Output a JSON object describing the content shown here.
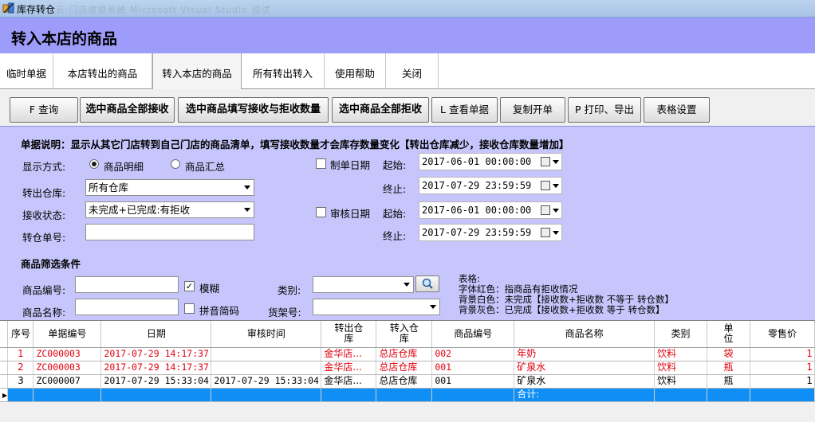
{
  "window": {
    "title": "库存转仓",
    "ghost_text": "云·门店收银系统   Microsoft Visual Studio 调试"
  },
  "page": {
    "title": "转入本店的商品"
  },
  "tabs": [
    "临时单据",
    "本店转出的商品",
    "转入本店的商品",
    "所有转出转入",
    "使用帮助",
    "关闭"
  ],
  "toolbar": [
    "F 查询",
    "选中商品全部接收",
    "选中商品填写接收与拒收数量",
    "选中商品全部拒收",
    "L 查看单据",
    "复制开单",
    "P 打印、导出",
    "表格设置"
  ],
  "filters": {
    "description": "单据说明：显示从其它门店转到自己门店的商品清单，填写接收数量才会库存数量变化【转出仓库减少，接收仓库数量增加】",
    "display_mode_label": "显示方式:",
    "display_mode_options": [
      "商品明细",
      "商品汇总"
    ],
    "display_mode_selected": "商品明细",
    "out_warehouse_label": "转出仓库:",
    "out_warehouse_value": "所有仓库",
    "receive_status_label": "接收状态:",
    "receive_status_value": "未完成+已完成:有拒收",
    "transfer_no_label": "转仓单号:",
    "transfer_no_value": "",
    "make_date_label": "制单日期",
    "make_date_checked": false,
    "audit_date_label": "审核日期",
    "audit_date_checked": false,
    "start_label": "起始:",
    "end_label": "终止:",
    "make_start": "2017-06-01 00:00:00",
    "make_end": "2017-07-29 23:59:59",
    "audit_start": "2017-06-01 00:00:00",
    "audit_end": "2017-07-29 23:59:59"
  },
  "product_filter": {
    "section_title": "商品筛选条件",
    "code_label": "商品编号:",
    "code_value": "",
    "fuzzy_label": "模糊",
    "fuzzy_checked": true,
    "name_label": "商品名称:",
    "name_value": "",
    "pinyin_label": "拼音简码",
    "pinyin_checked": false,
    "category_label": "类别:",
    "category_value": "",
    "shelf_label": "货架号:",
    "shelf_value": ""
  },
  "legend": [
    "表格:",
    "字体红色：指商品有拒收情况",
    "背景白色：未完成【接收数+拒收数 不等于 转仓数】",
    "背景灰色：已完成【接收数+拒收数 等于 转仓数】"
  ],
  "table": {
    "columns": [
      "序号",
      "单据编号",
      "日期",
      "审核时间",
      "转出仓\n库",
      "转入仓\n库",
      "商品编号",
      "商品名称",
      "类别",
      "单\n位",
      "零售价"
    ],
    "rows": [
      {
        "seq": "1",
        "doc_no": "ZC000003",
        "date": "2017-07-29 14:17:37",
        "audit_time": "",
        "out_wh": "金华店...",
        "in_wh": "总店仓库",
        "code": "002",
        "name": "年奶",
        "category": "饮料",
        "unit": "袋",
        "price": "1",
        "red": true
      },
      {
        "seq": "2",
        "doc_no": "ZC000003",
        "date": "2017-07-29 14:17:37",
        "audit_time": "",
        "out_wh": "金华店...",
        "in_wh": "总店仓库",
        "code": "001",
        "name": "矿泉水",
        "category": "饮料",
        "unit": "瓶",
        "price": "1",
        "red": true
      },
      {
        "seq": "3",
        "doc_no": "ZC000007",
        "date": "2017-07-29 15:33:04",
        "audit_time": "2017-07-29 15:33:04",
        "out_wh": "金华店...",
        "in_wh": "总店仓库",
        "code": "001",
        "name": "矿泉水",
        "category": "饮料",
        "unit": "瓶",
        "price": "1",
        "red": false
      }
    ],
    "total_label": "合计:"
  },
  "colors": {
    "header_band": "#9d9cfb",
    "filter_panel": "#c7c6fc",
    "red_text": "#e0000e",
    "summary_row": "#0f8ff5"
  }
}
